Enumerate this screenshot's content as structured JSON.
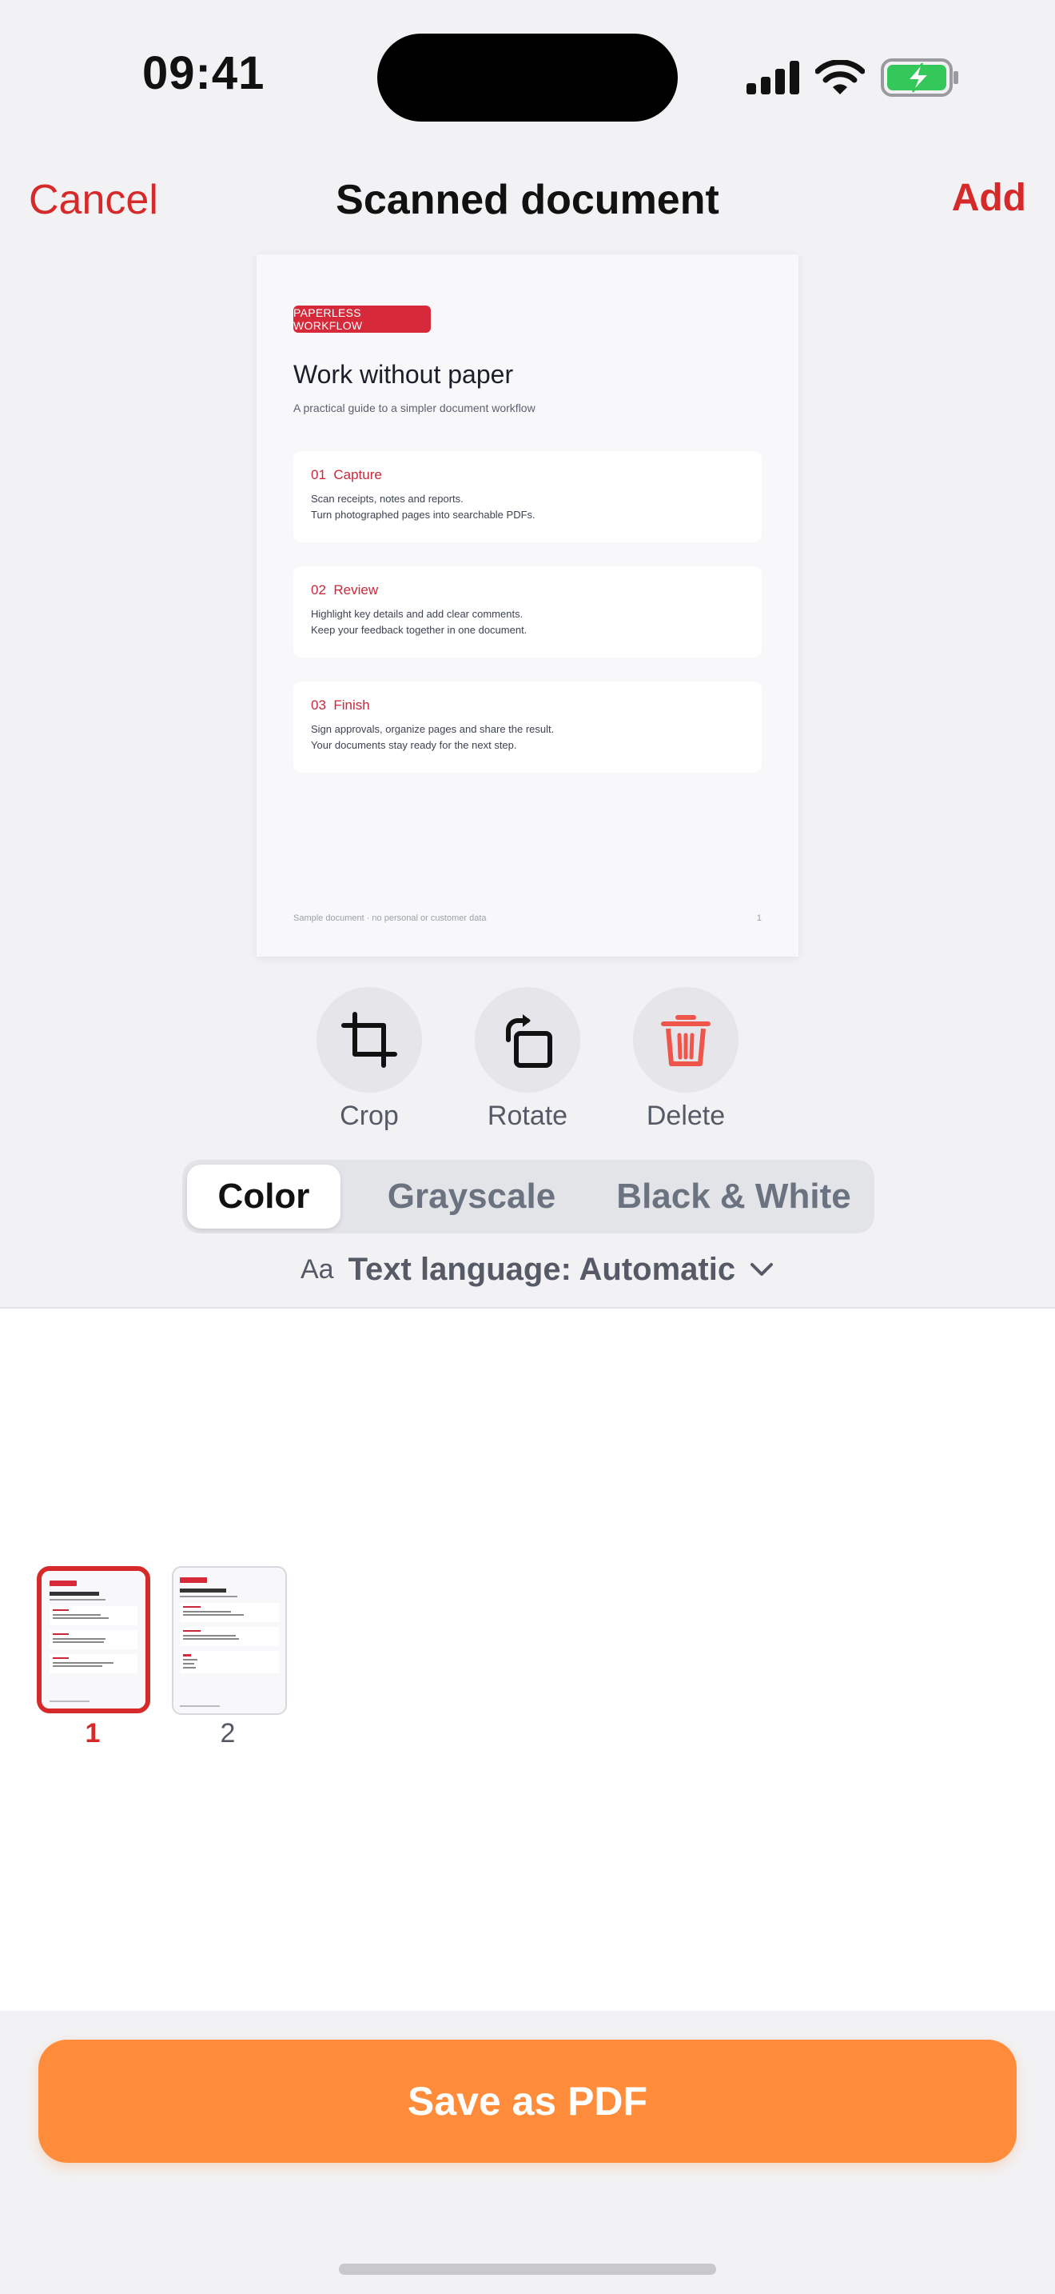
{
  "status": {
    "time": "09:41"
  },
  "nav": {
    "cancel": "Cancel",
    "title": "Scanned document",
    "add": "Add"
  },
  "document": {
    "tag": "PAPERLESS WORKFLOW",
    "title": "Work without paper",
    "subtitle": "A practical guide to a simpler document workflow",
    "sections": [
      {
        "num": "01",
        "title": "Capture",
        "lines": [
          "Scan receipts, notes and reports.",
          "Turn photographed pages into searchable PDFs."
        ]
      },
      {
        "num": "02",
        "title": "Review",
        "lines": [
          "Highlight key details and add clear comments.",
          "Keep your feedback together in one document."
        ]
      },
      {
        "num": "03",
        "title": "Finish",
        "lines": [
          "Sign approvals, organize pages and share the result.",
          "Your documents stay ready for the next step."
        ]
      }
    ],
    "footer": "Sample document · no personal or customer data",
    "page_number": "1"
  },
  "tools": {
    "crop": "Crop",
    "rotate": "Rotate",
    "delete": "Delete"
  },
  "filters": {
    "options": [
      "Color",
      "Grayscale",
      "Black & White"
    ],
    "selected": "Color"
  },
  "language": {
    "icon_text": "Aa",
    "label": "Text language: Automatic"
  },
  "pages": [
    {
      "label": "1",
      "selected": true
    },
    {
      "label": "2",
      "selected": false
    }
  ],
  "save_button": "Save as PDF",
  "colors": {
    "accent": "#d62a2a",
    "save": "#ff8c3a",
    "battery": "#34c759"
  }
}
